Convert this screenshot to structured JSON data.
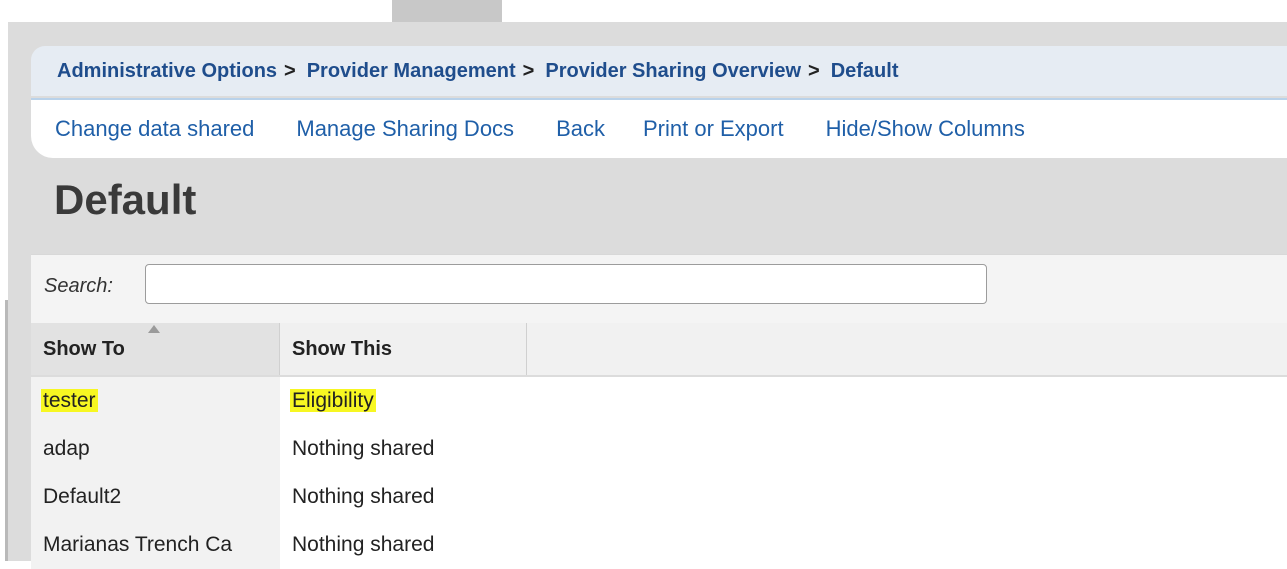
{
  "breadcrumb": {
    "items": [
      "Administrative Options",
      "Provider Management",
      "Provider Sharing Overview",
      "Default"
    ],
    "separator": ">"
  },
  "actions": [
    "Change data shared",
    "Manage Sharing Docs",
    "Back",
    "Print or Export",
    "Hide/Show Columns"
  ],
  "page_title": "Default",
  "search": {
    "label": "Search:",
    "value": "",
    "placeholder": ""
  },
  "table": {
    "columns": [
      "Show To",
      "Show This"
    ],
    "sort_icon": "sort-ascending-icon",
    "rows": [
      {
        "show_to": "tester",
        "show_this": "Eligibility",
        "highlighted": true
      },
      {
        "show_to": "adap",
        "show_this": "Nothing shared"
      },
      {
        "show_to": "Default2",
        "show_this": "Nothing shared"
      },
      {
        "show_to": "Marianas Trench Ca",
        "show_this": "Nothing shared"
      }
    ]
  },
  "colors": {
    "link": "#1f5fa8",
    "breadcrumb": "#1f4d8c",
    "highlight": "#f7f722",
    "background": "#dcdcdc"
  }
}
